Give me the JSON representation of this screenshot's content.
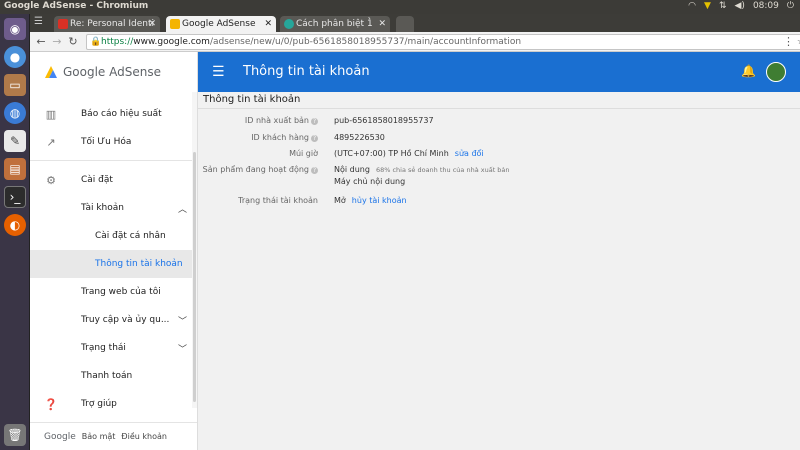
{
  "window": {
    "title": "Google AdSense - Chromium",
    "clock": "08:09"
  },
  "tabs": [
    {
      "label": "Re: Personal Identi",
      "active": false,
      "color": "#d93025"
    },
    {
      "label": "Google AdSense",
      "active": true,
      "color": "#f4b400"
    },
    {
      "label": "Cách phân biệt 1̀",
      "active": false,
      "color": "#26a69a"
    }
  ],
  "address": {
    "scheme": "https://",
    "host": "www.google.com",
    "path": "/adsense/new/u/0/pub-6561858018955737/main/accountInformation"
  },
  "brand": {
    "name": "Google AdSense",
    "accent": "#1a6fd1"
  },
  "sidebar": {
    "items": [
      {
        "label": "Báo cáo hiệu suất",
        "icon": "bar-chart-icon"
      },
      {
        "label": "Tối Ưu Hóa",
        "icon": "trending-up-icon"
      },
      {
        "label": "Cài đặt",
        "icon": "gear-icon"
      },
      {
        "label": "Tài khoản",
        "icon": ""
      },
      {
        "label": "Cài đặt cá nhân",
        "icon": ""
      },
      {
        "label": "Thông tin tài khoản",
        "icon": ""
      },
      {
        "label": "Trang web của tôi",
        "icon": ""
      },
      {
        "label": "Truy cập và ủy qu...",
        "icon": ""
      },
      {
        "label": "Trạng thái",
        "icon": ""
      },
      {
        "label": "Thanh toán",
        "icon": ""
      },
      {
        "label": "Trợ giúp",
        "icon": "help-icon"
      }
    ],
    "footer": {
      "google": "Google",
      "privacy": "Bảo mật",
      "terms": "Điều khoản"
    }
  },
  "appbar": {
    "title": "Thông tin tài khoản"
  },
  "content": {
    "title": "Thông tin tài khoản",
    "fields": [
      {
        "key": "ID nhà xuất bản",
        "value": "pub-6561858018955737"
      },
      {
        "key": "ID khách hàng",
        "value": "4895226530"
      },
      {
        "key": "Múi giờ",
        "value": "(UTC+07:00) TP Hồ Chí Minh",
        "link": "sửa đổi"
      },
      {
        "key": "Sản phẩm đang hoạt động",
        "value": "Nội dung",
        "note": "68% chia sẻ doanh thu của nhà xuất bản",
        "value2": "Máy chủ nội dung"
      },
      {
        "key": "Trạng thái tài khoản",
        "value": "Mở",
        "link": "hủy tài khoản"
      }
    ]
  }
}
